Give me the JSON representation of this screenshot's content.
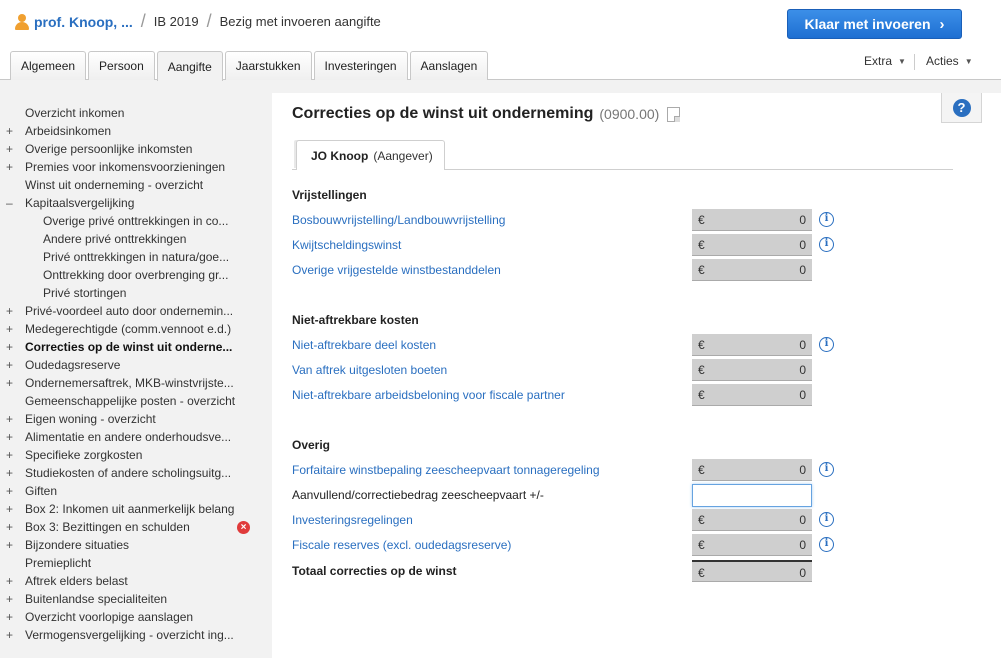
{
  "header": {
    "client": "prof. Knoop, ...",
    "year": "IB 2019",
    "status": "Bezig met invoeren aangifte",
    "primary_button": "Klaar met invoeren",
    "tabs": [
      "Algemeen",
      "Persoon",
      "Aangifte",
      "Jaarstukken",
      "Investeringen",
      "Aanslagen"
    ],
    "active_tab": "Aangifte",
    "menus": {
      "extra": "Extra",
      "acties": "Acties"
    }
  },
  "sidebar": {
    "items": [
      {
        "label": "Overzicht inkomen",
        "toggle": ""
      },
      {
        "label": "Arbeidsinkomen",
        "toggle": "+"
      },
      {
        "label": "Overige persoonlijke inkomsten",
        "toggle": "+"
      },
      {
        "label": "Premies voor inkomensvoorzieningen",
        "toggle": "+"
      },
      {
        "label": "Winst uit onderneming - overzicht",
        "toggle": ""
      },
      {
        "label": "Kapitaalsvergelijking",
        "toggle": "–"
      },
      {
        "label": "Overige privé onttrekkingen in co...",
        "toggle": "",
        "sub": true
      },
      {
        "label": "Andere privé onttrekkingen",
        "toggle": "",
        "sub": true
      },
      {
        "label": "Privé onttrekkingen in natura/goe...",
        "toggle": "",
        "sub": true
      },
      {
        "label": "Onttrekking door overbrenging gr...",
        "toggle": "",
        "sub": true
      },
      {
        "label": "Privé stortingen",
        "toggle": "",
        "sub": true
      },
      {
        "label": "Privé-voordeel auto door ondernemin...",
        "toggle": "+"
      },
      {
        "label": "Medegerechtigde (comm.vennoot e.d.)",
        "toggle": "+"
      },
      {
        "label": "Correcties op de winst uit onderne...",
        "toggle": "+",
        "active": true
      },
      {
        "label": "Oudedagsreserve",
        "toggle": "+"
      },
      {
        "label": "Ondernemersaftrek, MKB-winstvrijste...",
        "toggle": "+"
      },
      {
        "label": "Gemeenschappelijke posten - overzicht",
        "toggle": ""
      },
      {
        "label": "Eigen woning - overzicht",
        "toggle": "+"
      },
      {
        "label": "Alimentatie en andere onderhoudsve...",
        "toggle": "+"
      },
      {
        "label": "Specifieke zorgkosten",
        "toggle": "+"
      },
      {
        "label": "Studiekosten of andere scholingsuitg...",
        "toggle": "+"
      },
      {
        "label": "Giften",
        "toggle": "+"
      },
      {
        "label": "Box 2: Inkomen uit aanmerkelijk belang",
        "toggle": "+"
      },
      {
        "label": "Box 3: Bezittingen en schulden",
        "toggle": "+",
        "error": true
      },
      {
        "label": "Bijzondere situaties",
        "toggle": "+"
      },
      {
        "label": "Premieplicht",
        "toggle": ""
      },
      {
        "label": "Aftrek elders belast",
        "toggle": "+"
      },
      {
        "label": "Buitenlandse specialiteiten",
        "toggle": "+"
      },
      {
        "label": "Overzicht voorlopige aanslagen",
        "toggle": "+"
      },
      {
        "label": "Vermogensvergelijking - overzicht ing...",
        "toggle": "+"
      }
    ]
  },
  "main": {
    "title": "Correcties op de winst uit onderneming",
    "code": "(0900.00)",
    "person_tab": {
      "name": "JO Knoop",
      "role": "(Aangever)"
    },
    "currency": "€",
    "sections": [
      {
        "title": "Vrijstellingen",
        "rows": [
          {
            "label": "Bosbouwvrijstelling/Landbouwvrijstelling",
            "value": "0",
            "info": true
          },
          {
            "label": "Kwijtscheldingswinst",
            "value": "0",
            "info": true
          },
          {
            "label": "Overige vrijgestelde winstbestanddelen",
            "value": "0",
            "info": false
          }
        ]
      },
      {
        "title": "Niet-aftrekbare kosten",
        "rows": [
          {
            "label": "Niet-aftrekbare deel kosten",
            "value": "0",
            "info": true
          },
          {
            "label": "Van aftrek uitgesloten boeten",
            "value": "0",
            "info": false
          },
          {
            "label": "Niet-aftrekbare arbeidsbeloning voor fiscale partner",
            "value": "0",
            "info": false
          }
        ]
      },
      {
        "title": "Overig",
        "rows": [
          {
            "label": "Forfaitaire winstbepaling zeescheepvaart tonnageregeling",
            "value": "0",
            "info": true
          },
          {
            "label": "Aanvullend/correctiebedrag zeescheepvaart +/-",
            "value": "",
            "input": true,
            "info": false
          },
          {
            "label": "Investeringsregelingen",
            "value": "0",
            "info": true
          },
          {
            "label": "Fiscale reserves (excl. oudedagsreserve)",
            "value": "0",
            "info": true
          }
        ]
      }
    ],
    "total": {
      "label": "Totaal correcties op de winst",
      "value": "0"
    }
  },
  "colors": {
    "link": "#2a6fc0",
    "primary": "#1e6fd2",
    "error": "#e03b3b"
  }
}
